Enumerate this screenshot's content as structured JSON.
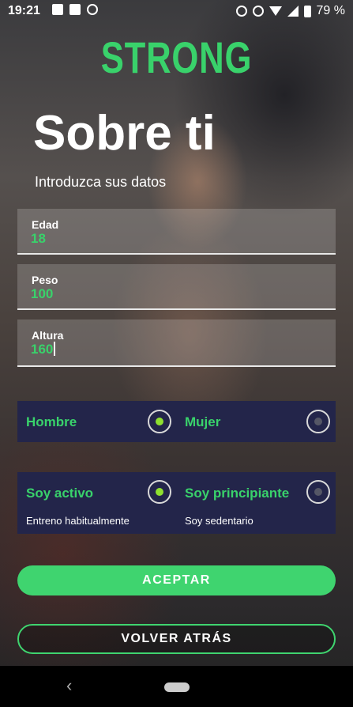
{
  "status_bar": {
    "time": "19:21",
    "battery_pct": "79 %",
    "left_icons": [
      "image-icon",
      "laptop-icon",
      "shield-icon"
    ],
    "right_icons": [
      "alarm-icon",
      "mute-icon",
      "wifi-icon",
      "signal-icon",
      "battery-icon"
    ]
  },
  "app": {
    "logo": "STRONG",
    "accent": "#39d26b",
    "panel_color": "#23254a"
  },
  "header": {
    "title": "Sobre ti",
    "subtitle": "Introduzca sus datos"
  },
  "form": {
    "age": {
      "label": "Edad",
      "value": "18"
    },
    "weight": {
      "label": "Peso",
      "value": "100"
    },
    "height": {
      "label": "Altura",
      "value": "160"
    }
  },
  "gender": {
    "male": {
      "label": "Hombre",
      "selected": true
    },
    "female": {
      "label": "Mujer",
      "selected": false
    }
  },
  "activity": {
    "active": {
      "label": "Soy activo",
      "description": "Entreno habitualmente",
      "selected": true
    },
    "beginner": {
      "label": "Soy principiante",
      "description": "Soy sedentario",
      "selected": false
    }
  },
  "actions": {
    "accept": "ACEPTAR",
    "back": "VOLVER ATRÁS"
  },
  "nav_bar": {
    "icons": [
      "back-icon",
      "home-pill-icon"
    ]
  }
}
